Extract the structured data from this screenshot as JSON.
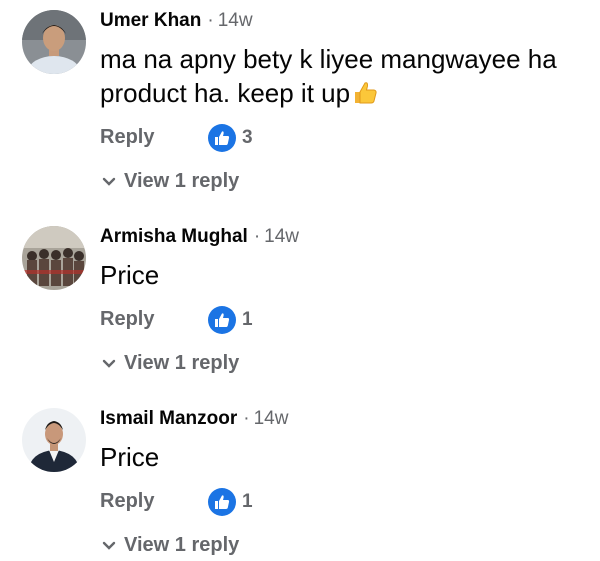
{
  "comments": [
    {
      "author": "Umer Khan",
      "time": "14w",
      "separator": "·",
      "text_lines": [
        "ma na apny bety k liyee mangwayee ha",
        "product ha. keep it up"
      ],
      "emoji": "thumbs-up-emoji",
      "reply_label": "Reply",
      "likes": "3",
      "view_replies": "View 1 reply",
      "avatar_icon": "avatar-man-photo"
    },
    {
      "author": "Armisha Mughal",
      "time": "14w",
      "separator": "·",
      "text": "Price",
      "reply_label": "Reply",
      "likes": "1",
      "view_replies": "View 1 reply",
      "avatar_icon": "avatar-crowd-photo"
    },
    {
      "author": "Ismail Manzoor",
      "time": "14w",
      "separator": "·",
      "text": "Price",
      "reply_label": "Reply",
      "likes": "1",
      "view_replies": "View 1 reply",
      "avatar_icon": "avatar-man-suit-photo"
    }
  ],
  "colors": {
    "like_blue": "#1b74e4",
    "secondary_text": "#65676b",
    "primary_text": "#050505"
  }
}
